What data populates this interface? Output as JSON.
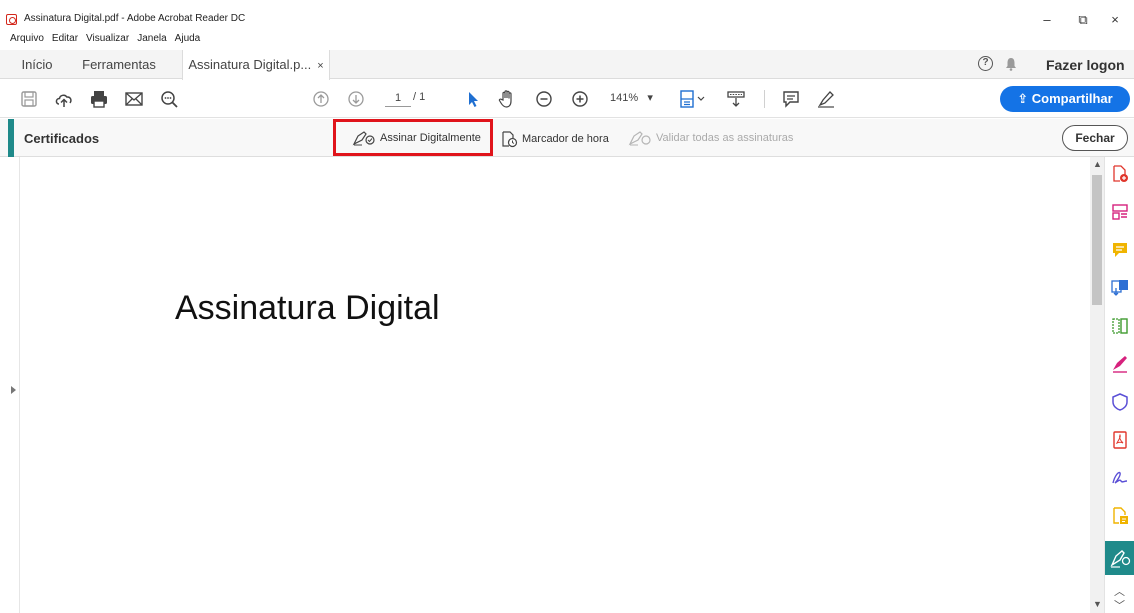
{
  "window": {
    "title": "Assinatura Digital.pdf - Adobe Acrobat Reader DC",
    "minimize": "–",
    "restore": "⧉",
    "close": "×"
  },
  "menu": [
    "Arquivo",
    "Editar",
    "Visualizar",
    "Janela",
    "Ajuda"
  ],
  "tabs": {
    "home": "Início",
    "tools": "Ferramentas",
    "document": "Assinatura Digital.p...",
    "close_glyph": "×"
  },
  "header": {
    "help": "?",
    "login": "Fazer logon"
  },
  "toolbar": {
    "page_current": "1",
    "page_total": "/ 1",
    "zoom": "141%",
    "zoom_caret": "▾",
    "share_label": "Compartilhar"
  },
  "certificates": {
    "title": "Certificados",
    "sign": "Assinar Digitalmente",
    "timestamp": "Marcador de hora",
    "validate": "Validar todas as assinaturas",
    "close": "Fechar"
  },
  "document": {
    "heading": "Assinatura Digital"
  },
  "colors": {
    "accent_teal": "#1f8a8a",
    "share_blue": "#1473e6",
    "highlight_red": "#e0141b"
  }
}
